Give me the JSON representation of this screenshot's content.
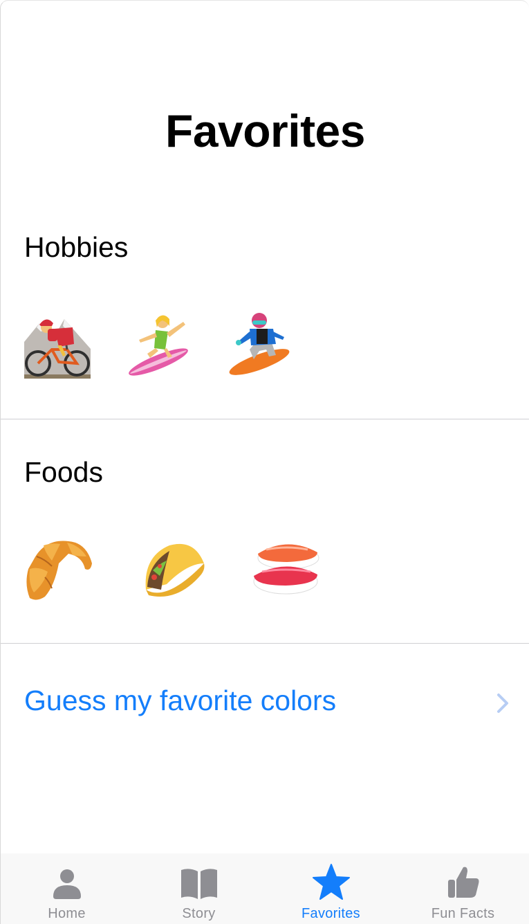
{
  "page": {
    "title": "Favorites"
  },
  "hobbies": {
    "title": "Hobbies",
    "items": [
      {
        "icon": "woman-mountain-biking-icon"
      },
      {
        "icon": "woman-surfing-icon"
      },
      {
        "icon": "snowboarder-icon"
      }
    ]
  },
  "foods": {
    "title": "Foods",
    "items": [
      {
        "icon": "croissant-icon"
      },
      {
        "icon": "taco-icon"
      },
      {
        "icon": "sushi-icon"
      }
    ]
  },
  "guess": {
    "label": "Guess my favorite colors",
    "icon": "chevron-right-icon"
  },
  "tabbar": {
    "tabs": [
      {
        "label": "Home",
        "icon": "person-icon",
        "active": false
      },
      {
        "label": "Story",
        "icon": "book-icon",
        "active": false
      },
      {
        "label": "Favorites",
        "icon": "star-icon",
        "active": true
      },
      {
        "label": "Fun Facts",
        "icon": "thumbs-up-icon",
        "active": false
      }
    ]
  },
  "colors": {
    "accent": "#147EFB",
    "inactive": "#8e8e93",
    "divider": "#cfcfd3"
  }
}
